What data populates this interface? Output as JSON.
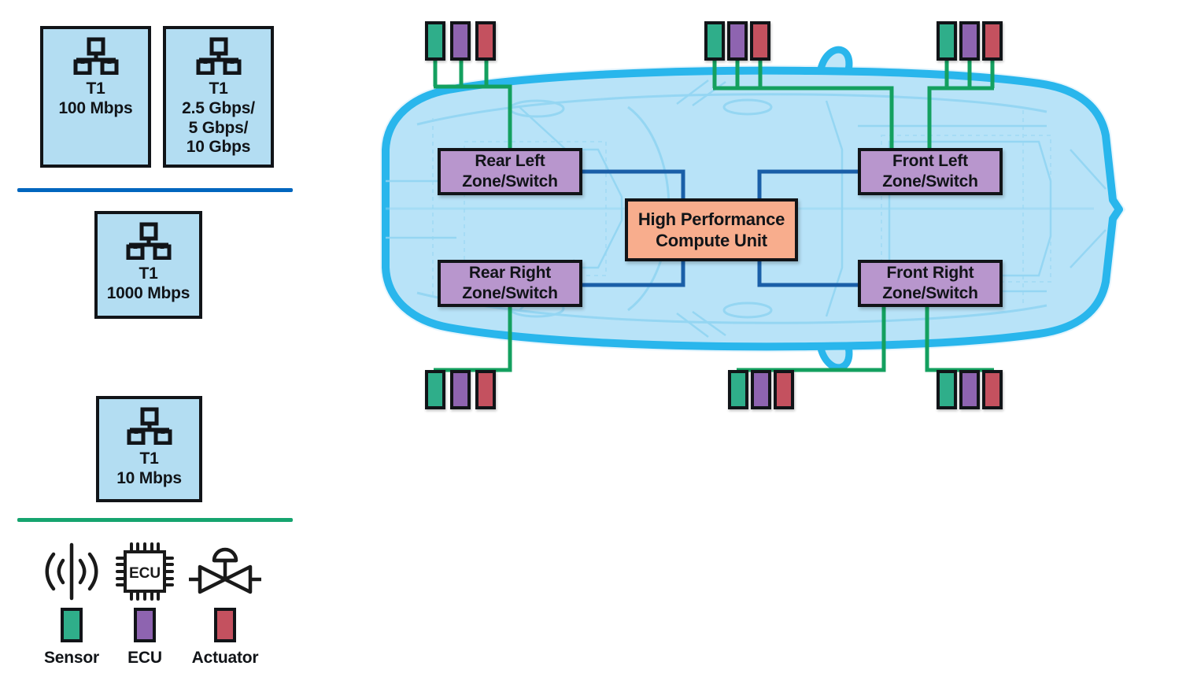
{
  "legend": {
    "speed_cards": [
      {
        "id": "t1-100m",
        "icon": "network-icon",
        "label": "T1\n100 Mbps"
      },
      {
        "id": "t1-multi",
        "icon": "network-icon",
        "label": "T1\n2.5 Gbps/\n5 Gbps/\n10 Gbps"
      },
      {
        "id": "t1-1000m",
        "icon": "network-icon",
        "label": "T1\n1000 Mbps"
      },
      {
        "id": "t1-10m",
        "icon": "network-icon",
        "label": "T1\n10 Mbps"
      }
    ],
    "dividers": [
      {
        "id": "divider-blue",
        "color": "#0066be"
      },
      {
        "id": "divider-green",
        "color": "#16a46f"
      }
    ],
    "symbols": [
      {
        "id": "sensor",
        "icon": "sensor-wave-icon",
        "label": "Sensor",
        "color": "#2fae8a"
      },
      {
        "id": "ecu",
        "icon": "ecu-chip-icon",
        "label": "ECU",
        "color": "#8e64b0"
      },
      {
        "id": "actuator",
        "icon": "actuator-valve-icon",
        "label": "Actuator",
        "color": "#c4515f"
      }
    ],
    "ecu_chip_text": "ECU"
  },
  "diagram": {
    "compute_unit": {
      "label": "High Performance\nCompute Unit",
      "color": "#f8ad8d"
    },
    "zones": [
      {
        "id": "rear-left",
        "label": "Rear Left\nZone/Switch"
      },
      {
        "id": "rear-right",
        "label": "Rear Right\nZone/Switch"
      },
      {
        "id": "front-left",
        "label": "Front Left\nZone/Switch"
      },
      {
        "id": "front-right",
        "label": "Front Right\nZone/Switch"
      }
    ],
    "node_cluster_types": [
      "Sensor",
      "ECU",
      "Actuator"
    ],
    "node_clusters": [
      {
        "id": "cluster-top-left",
        "connects_to": "rear-left"
      },
      {
        "id": "cluster-top-middle",
        "connects_to": "front-left"
      },
      {
        "id": "cluster-top-right",
        "connects_to": "front-left"
      },
      {
        "id": "cluster-bottom-left",
        "connects_to": "rear-right"
      },
      {
        "id": "cluster-bottom-middle",
        "connects_to": "front-right"
      },
      {
        "id": "cluster-bottom-right",
        "connects_to": "front-right"
      }
    ],
    "colors": {
      "sensor": "#2fae8a",
      "ecu": "#8e64b0",
      "actuator": "#c4515f",
      "zone": "#b896cd",
      "compute": "#f8ad8d",
      "car_body": "#b8e3f8",
      "car_outline": "#29b6ec",
      "ethernet_link": "#14a05f",
      "backbone_link": "#1a5fa8",
      "card_fill": "#b3ddf2",
      "stroke": "#111418"
    }
  }
}
